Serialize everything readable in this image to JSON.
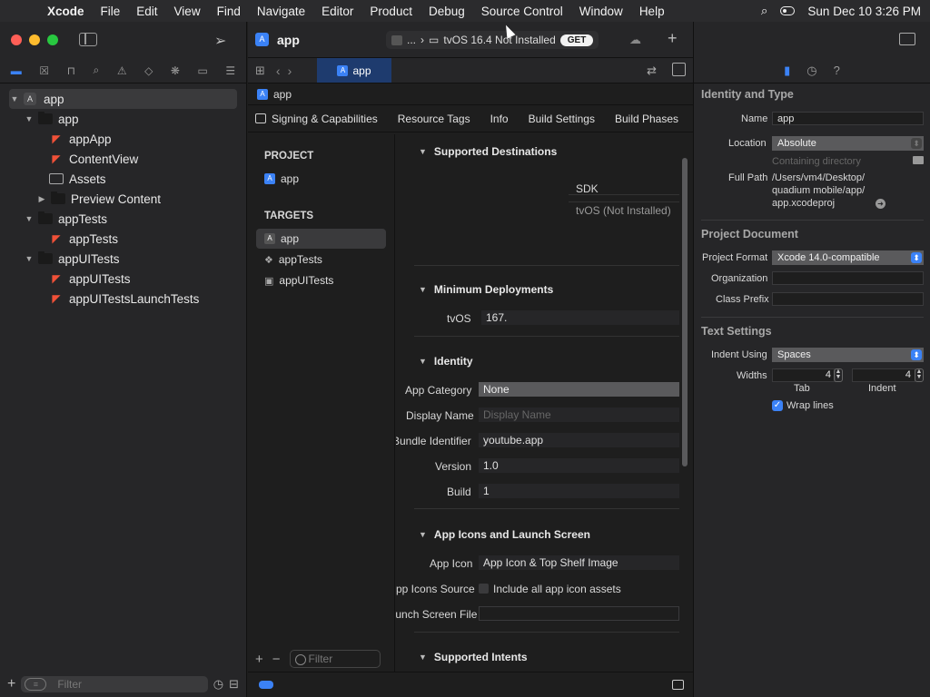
{
  "menubar": {
    "app_name": "Xcode",
    "items": [
      "File",
      "Edit",
      "View",
      "Find",
      "Navigate",
      "Editor",
      "Product",
      "Debug",
      "Source Control",
      "Window",
      "Help"
    ],
    "datetime": "Sun Dec 10  3:26 PM"
  },
  "toolbar": {
    "project_title": "app",
    "scheme_prefix": "...",
    "destination": "tvOS 16.4 Not Installed",
    "get_label": "GET",
    "tab_label": "app",
    "jump_label": "app"
  },
  "navigator": {
    "tree": [
      {
        "label": "app",
        "kind": "project",
        "level": 0,
        "open": true
      },
      {
        "label": "app",
        "kind": "folder",
        "level": 1,
        "open": true
      },
      {
        "label": "appApp",
        "kind": "swift",
        "level": 2
      },
      {
        "label": "ContentView",
        "kind": "swift",
        "level": 2
      },
      {
        "label": "Assets",
        "kind": "assets",
        "level": 2
      },
      {
        "label": "Preview Content",
        "kind": "folder",
        "level": 2,
        "open": false
      },
      {
        "label": "appTests",
        "kind": "folder",
        "level": 1,
        "open": true
      },
      {
        "label": "appTests",
        "kind": "swift",
        "level": 2
      },
      {
        "label": "appUITests",
        "kind": "folder",
        "level": 1,
        "open": true
      },
      {
        "label": "appUITests",
        "kind": "swift",
        "level": 2
      },
      {
        "label": "appUITestsLaunchTests",
        "kind": "swift",
        "level": 2
      }
    ],
    "filter_placeholder": "Filter"
  },
  "settings_tabs": [
    "Signing & Capabilities",
    "Resource Tags",
    "Info",
    "Build Settings",
    "Build Phases"
  ],
  "targets_panel": {
    "project_header": "PROJECT",
    "project_item": "app",
    "targets_header": "TARGETS",
    "targets": [
      "app",
      "appTests",
      "appUITests"
    ],
    "filter_placeholder": "Filter"
  },
  "general": {
    "supported_destinations": {
      "title": "Supported Destinations",
      "sdk_header": "SDK",
      "sdk_value": "tvOS (Not Installed)"
    },
    "minimum_deployments": {
      "title": "Minimum Deployments",
      "label": "tvOS",
      "value": "167."
    },
    "identity": {
      "title": "Identity",
      "app_category_label": "App Category",
      "app_category_value": "None",
      "display_name_label": "Display Name",
      "display_name_placeholder": "Display Name",
      "bundle_id_label": "Bundle Identifier",
      "bundle_id_value": "youtube.app",
      "version_label": "Version",
      "version_value": "1.0",
      "build_label": "Build",
      "build_value": "1"
    },
    "app_icons": {
      "title": "App Icons and Launch Screen",
      "app_icon_label": "App Icon",
      "app_icon_value": "App Icon & Top Shelf Image",
      "icons_source_label": "App Icons Source",
      "include_all_label": "Include all app icon assets",
      "launch_screen_label": "Launch Screen File"
    },
    "supported_intents": {
      "title": "Supported Intents"
    }
  },
  "inspector": {
    "identity_type": {
      "title": "Identity and Type",
      "name_label": "Name",
      "name_value": "app",
      "location_label": "Location",
      "location_value": "Absolute",
      "containing_label": "Containing directory",
      "full_path_label": "Full Path",
      "full_path_line1": "/Users/vm4/Desktop/",
      "full_path_line2": "quadium mobile/app/",
      "full_path_line3": "app.xcodeproj"
    },
    "project_document": {
      "title": "Project Document",
      "format_label": "Project Format",
      "format_value": "Xcode 14.0-compatible",
      "org_label": "Organization",
      "prefix_label": "Class Prefix"
    },
    "text_settings": {
      "title": "Text Settings",
      "indent_using_label": "Indent Using",
      "indent_using_value": "Spaces",
      "widths_label": "Widths",
      "tab_value": "4",
      "indent_value": "4",
      "tab_caption": "Tab",
      "indent_caption": "Indent",
      "wrap_lines_label": "Wrap lines",
      "wrap_lines_checked": true
    }
  },
  "colors": {
    "accent": "#3b82f6",
    "selected_tab": "#1e3b6e"
  }
}
